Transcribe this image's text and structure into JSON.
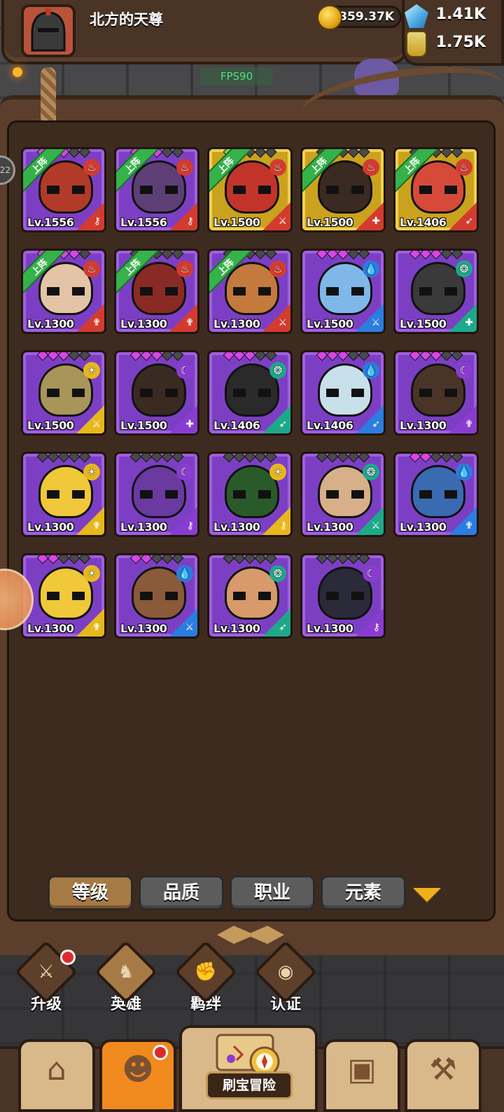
{
  "player": {
    "name": "北方的天尊"
  },
  "resources": {
    "coins": "359.37K",
    "gems": "1.41K",
    "potions": "1.75K"
  },
  "fps": "FPS90",
  "side_tag": "22",
  "heroes": [
    {
      "level": "Lv.1556",
      "deployed": true,
      "deploy_label": "上阵",
      "element": "fire",
      "elem_color": "#d33b2f",
      "elem_glyph": "♨",
      "class_glyph": "⚷",
      "class_color": "#d33b2f",
      "rarity": "purple",
      "stars": [
        "on",
        "on",
        "on",
        "off",
        "off"
      ],
      "skin": "#b23a28"
    },
    {
      "level": "Lv.1556",
      "deployed": true,
      "deploy_label": "上阵",
      "element": "fire",
      "elem_color": "#d33b2f",
      "elem_glyph": "♨",
      "class_glyph": "⚷",
      "class_color": "#d33b2f",
      "rarity": "purple",
      "stars": [
        "on",
        "on",
        "on",
        "off",
        "off"
      ],
      "skin": "#5d3f76"
    },
    {
      "level": "Lv.1500",
      "deployed": true,
      "deploy_label": "上阵",
      "element": "fire",
      "elem_color": "#d33b2f",
      "elem_glyph": "♨",
      "class_glyph": "⚔",
      "class_color": "#d33b2f",
      "rarity": "gold",
      "stars": [
        "green",
        "green",
        "off",
        "off",
        "off"
      ],
      "skin": "#c2342a"
    },
    {
      "level": "Lv.1500",
      "deployed": true,
      "deploy_label": "上阵",
      "element": "fire",
      "elem_color": "#d33b2f",
      "elem_glyph": "♨",
      "class_glyph": "✚",
      "class_color": "#d33b2f",
      "rarity": "gold",
      "stars": [
        "off",
        "off",
        "off",
        "off",
        "off"
      ],
      "skin": "#3a2a22"
    },
    {
      "level": "Lv.1406",
      "deployed": true,
      "deploy_label": "上阵",
      "element": "fire",
      "elem_color": "#d33b2f",
      "elem_glyph": "♨",
      "class_glyph": "➶",
      "class_color": "#d33b2f",
      "rarity": "gold",
      "stars": [
        "off",
        "off",
        "off",
        "off",
        "off"
      ],
      "skin": "#d64a3a"
    },
    {
      "level": "Lv.1300",
      "deployed": true,
      "deploy_label": "上阵",
      "element": "fire",
      "elem_color": "#d33b2f",
      "elem_glyph": "♨",
      "class_glyph": "✟",
      "class_color": "#d33b2f",
      "rarity": "purple",
      "stars": [
        "on",
        "on",
        "on",
        "on",
        "off"
      ],
      "skin": "#e3c4a6"
    },
    {
      "level": "Lv.1300",
      "deployed": true,
      "deploy_label": "上阵",
      "element": "fire",
      "elem_color": "#d33b2f",
      "elem_glyph": "♨",
      "class_glyph": "✟",
      "class_color": "#d33b2f",
      "rarity": "purple",
      "stars": [
        "off",
        "off",
        "off",
        "off",
        "off"
      ],
      "skin": "#8a2a24"
    },
    {
      "level": "Lv.1300",
      "deployed": true,
      "deploy_label": "上阵",
      "element": "fire",
      "elem_color": "#d33b2f",
      "elem_glyph": "♨",
      "class_glyph": "⚔",
      "class_color": "#d33b2f",
      "rarity": "purple",
      "stars": [
        "off",
        "off",
        "off",
        "off",
        "off"
      ],
      "skin": "#c47a3c"
    },
    {
      "level": "Lv.1500",
      "deployed": false,
      "deploy_label": "",
      "element": "water",
      "elem_color": "#2b7de0",
      "elem_glyph": "💧",
      "class_glyph": "⚔",
      "class_color": "#2b7de0",
      "rarity": "purple",
      "stars": [
        "on",
        "on",
        "on",
        "off",
        "off"
      ],
      "skin": "#7fb8e8"
    },
    {
      "level": "Lv.1500",
      "deployed": false,
      "deploy_label": "",
      "element": "wind",
      "elem_color": "#1ea88a",
      "elem_glyph": "❂",
      "class_glyph": "✚",
      "class_color": "#1ea88a",
      "rarity": "purple",
      "stars": [
        "on",
        "on",
        "on",
        "off",
        "off"
      ],
      "skin": "#3a3a3a"
    },
    {
      "level": "Lv.1500",
      "deployed": false,
      "deploy_label": "",
      "element": "light",
      "elem_color": "#e6b81c",
      "elem_glyph": "☀",
      "class_glyph": "⚔",
      "class_color": "#e6b81c",
      "rarity": "purple",
      "stars": [
        "on",
        "on",
        "on",
        "off",
        "off"
      ],
      "skin": "#a8955a"
    },
    {
      "level": "Lv.1500",
      "deployed": false,
      "deploy_label": "",
      "element": "dark",
      "elem_color": "#8a3cd0",
      "elem_glyph": "☾",
      "class_glyph": "✚",
      "class_color": "#8a3cd0",
      "rarity": "purple",
      "stars": [
        "on",
        "on",
        "on",
        "off",
        "off"
      ],
      "skin": "#3a2a22"
    },
    {
      "level": "Lv.1406",
      "deployed": false,
      "deploy_label": "",
      "element": "wind",
      "elem_color": "#1ea88a",
      "elem_glyph": "❂",
      "class_glyph": "➶",
      "class_color": "#1ea88a",
      "rarity": "purple",
      "stars": [
        "on",
        "on",
        "on",
        "off",
        "off"
      ],
      "skin": "#2a2a2a"
    },
    {
      "level": "Lv.1406",
      "deployed": false,
      "deploy_label": "",
      "element": "water",
      "elem_color": "#2b7de0",
      "elem_glyph": "💧",
      "class_glyph": "➶",
      "class_color": "#2b7de0",
      "rarity": "purple",
      "stars": [
        "on",
        "on",
        "on",
        "off",
        "off"
      ],
      "skin": "#c8e0ea"
    },
    {
      "level": "Lv.1300",
      "deployed": false,
      "deploy_label": "",
      "element": "dark",
      "elem_color": "#8a3cd0",
      "elem_glyph": "☾",
      "class_glyph": "✟",
      "class_color": "#8a3cd0",
      "rarity": "purple",
      "stars": [
        "on",
        "on",
        "on",
        "off",
        "off"
      ],
      "skin": "#4a3428"
    },
    {
      "level": "Lv.1300",
      "deployed": false,
      "deploy_label": "",
      "element": "light",
      "elem_color": "#e6b81c",
      "elem_glyph": "☀",
      "class_glyph": "✟",
      "class_color": "#e6b81c",
      "rarity": "purple",
      "stars": [
        "off",
        "off",
        "off",
        "off",
        "off"
      ],
      "skin": "#f0c83a"
    },
    {
      "level": "Lv.1300",
      "deployed": false,
      "deploy_label": "",
      "element": "dark",
      "elem_color": "#8a3cd0",
      "elem_glyph": "☾",
      "class_glyph": "⚷",
      "class_color": "#8a3cd0",
      "rarity": "purple",
      "stars": [
        "off",
        "off",
        "off",
        "off",
        "off"
      ],
      "skin": "#6a3aa0"
    },
    {
      "level": "Lv.1300",
      "deployed": false,
      "deploy_label": "",
      "element": "light",
      "elem_color": "#e6b81c",
      "elem_glyph": "☀",
      "class_glyph": "⚷",
      "class_color": "#e6b81c",
      "rarity": "purple",
      "stars": [
        "off",
        "off",
        "off",
        "off",
        "off"
      ],
      "skin": "#2a5a2a"
    },
    {
      "level": "Lv.1300",
      "deployed": false,
      "deploy_label": "",
      "element": "wind",
      "elem_color": "#1ea88a",
      "elem_glyph": "❂",
      "class_glyph": "⚔",
      "class_color": "#1ea88a",
      "rarity": "purple",
      "stars": [
        "off",
        "off",
        "off",
        "off",
        "off"
      ],
      "skin": "#d7b08a"
    },
    {
      "level": "Lv.1300",
      "deployed": false,
      "deploy_label": "",
      "element": "water",
      "elem_color": "#2b7de0",
      "elem_glyph": "💧",
      "class_glyph": "✟",
      "class_color": "#2b7de0",
      "rarity": "purple",
      "stars": [
        "on",
        "on",
        "off",
        "off",
        "off"
      ],
      "skin": "#3a6ab0"
    },
    {
      "level": "Lv.1300",
      "deployed": false,
      "deploy_label": "",
      "element": "light",
      "elem_color": "#e6b81c",
      "elem_glyph": "☀",
      "class_glyph": "✟",
      "class_color": "#e6b81c",
      "rarity": "purple",
      "stars": [
        "on",
        "on",
        "off",
        "off",
        "off"
      ],
      "skin": "#f0c83a"
    },
    {
      "level": "Lv.1300",
      "deployed": false,
      "deploy_label": "",
      "element": "water",
      "elem_color": "#2b7de0",
      "elem_glyph": "💧",
      "class_glyph": "⚔",
      "class_color": "#2b7de0",
      "rarity": "purple",
      "stars": [
        "on",
        "on",
        "off",
        "off",
        "off"
      ],
      "skin": "#8a5a3a"
    },
    {
      "level": "Lv.1300",
      "deployed": false,
      "deploy_label": "",
      "element": "wind",
      "elem_color": "#1ea88a",
      "elem_glyph": "❂",
      "class_glyph": "➶",
      "class_color": "#1ea88a",
      "rarity": "purple",
      "stars": [
        "off",
        "off",
        "off",
        "off",
        "off"
      ],
      "skin": "#d89a6a"
    },
    {
      "level": "Lv.1300",
      "deployed": false,
      "deploy_label": "",
      "element": "dark",
      "elem_color": "#8a3cd0",
      "elem_glyph": "☾",
      "class_glyph": "⚷",
      "class_color": "#8a3cd0",
      "rarity": "purple",
      "stars": [
        "off",
        "off",
        "off",
        "off",
        "off"
      ],
      "skin": "#2a2a3a"
    }
  ],
  "sort_tabs": [
    {
      "label": "等级",
      "active": true
    },
    {
      "label": "品质",
      "active": false
    },
    {
      "label": "职业",
      "active": false
    },
    {
      "label": "元素",
      "active": false
    }
  ],
  "sub_nav": [
    {
      "label": "升级",
      "icon": "sword-icon",
      "glyph": "⚔",
      "active": false,
      "dot": true
    },
    {
      "label": "英雄",
      "icon": "hero-icon",
      "glyph": "♞",
      "active": true,
      "dot": false
    },
    {
      "label": "羁绊",
      "icon": "bond-icon",
      "glyph": "✊",
      "active": false,
      "dot": false
    },
    {
      "label": "认证",
      "icon": "eye-icon",
      "glyph": "◉",
      "active": false,
      "dot": false
    }
  ],
  "bottom_nav": {
    "shop": {
      "icon": "shop-icon",
      "glyph": "⌂"
    },
    "heroes": {
      "icon": "hero-portrait-icon",
      "glyph": "☻",
      "dot": true
    },
    "adventure": {
      "label": "刷宝冒险",
      "icon": "map-compass-icon"
    },
    "inventory": {
      "icon": "backpack-icon",
      "glyph": "▣"
    },
    "forge": {
      "icon": "hammer-icon",
      "glyph": "⚒"
    }
  },
  "colors": {
    "rarity_purple": "#7c3fc4",
    "rarity_gold": "#caa21e",
    "tab_active": "#a67a45",
    "tab_inactive": "#5c5c5c",
    "badge_green": "#36b24a"
  }
}
